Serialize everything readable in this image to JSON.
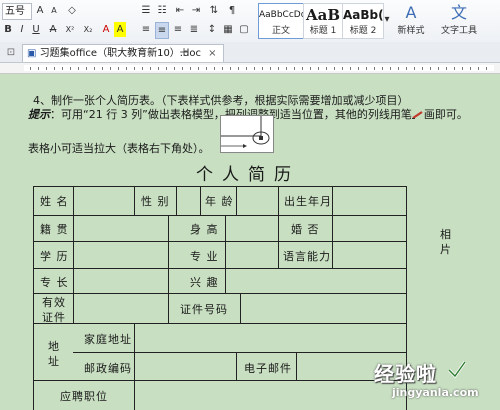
{
  "ribbon": {
    "font_size": "五号",
    "buttons": [
      "B",
      "I",
      "U",
      "A",
      "X²",
      "X₂",
      "A",
      "A"
    ],
    "styles": [
      {
        "sample": "AaBbCcDd",
        "name": "正文"
      },
      {
        "sample": "AaB",
        "name": "标题 1"
      },
      {
        "sample": "AaBb(",
        "name": "标题 2"
      }
    ],
    "new_style": "新样式",
    "text_tools": "文字工具",
    "icons": [
      "bold-icon",
      "italic-icon",
      "underline-icon",
      "new-style-icon",
      "text-tools-icon"
    ]
  },
  "tabbar": {
    "doc_tab": "习题集office（职大教育新10）.doc",
    "close": "×",
    "add": "+"
  },
  "document": {
    "task": "4、制作一张个人简历表。（下表样式供参考，根据实际需要增加或减少项目）",
    "tip_label": "提示",
    "tip_text": "：可用“21 行 3 列”做出表格模型，把列调整到适当位置，其他的列线用笔",
    "tip_end": "画即可。",
    "resize_hint": "表格小可适当拉大（表格右下角处）。",
    "title": "个人简历"
  },
  "table": {
    "name": "姓 名",
    "gender": "性 别",
    "age": "年 龄",
    "birth": "出生年月",
    "native": "籍 贯",
    "height": "身 高",
    "marital": "婚 否",
    "education": "学 历",
    "major": "专 业",
    "language": "语言能力",
    "specialty": "专 长",
    "hobby": "兴 趣",
    "photo_1": "相",
    "photo_2": "片",
    "valid_1": "有效",
    "valid_2": "证件",
    "id_number": "证件号码",
    "address_1": "地",
    "address_2": "址",
    "home_address": "家庭地址",
    "postcode": "邮政编码",
    "email": "电子邮件",
    "position": "应聘职位"
  },
  "watermark": {
    "text": "经验啦",
    "url": "jingyanla.com"
  }
}
